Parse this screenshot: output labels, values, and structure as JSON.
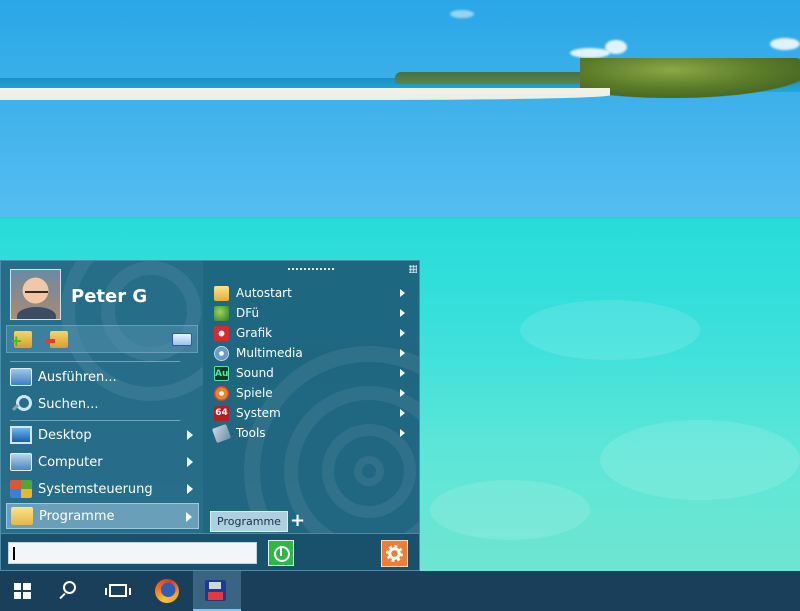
{
  "user": {
    "name": "Peter G"
  },
  "left_menu": {
    "items": [
      {
        "label": "Ausführen...",
        "icon": "run-icon",
        "has_arrow": false
      },
      {
        "label": "Suchen...",
        "icon": "search-icon",
        "has_arrow": false
      },
      {
        "label": "Desktop",
        "icon": "desktop-icon",
        "has_arrow": true
      },
      {
        "label": "Computer",
        "icon": "computer-icon",
        "has_arrow": true
      },
      {
        "label": "Systemsteuerung",
        "icon": "control-panel-icon",
        "has_arrow": true
      },
      {
        "label": "Programme",
        "icon": "programs-folder-icon",
        "has_arrow": true,
        "active": true
      }
    ]
  },
  "programs": {
    "items": [
      {
        "label": "Autostart",
        "icon": "folder-icon"
      },
      {
        "label": "DFü",
        "icon": "network-icon"
      },
      {
        "label": "Grafik",
        "icon": "graphics-icon"
      },
      {
        "label": "Multimedia",
        "icon": "media-disc-icon"
      },
      {
        "label": "Sound",
        "icon": "audition-icon",
        "icon_text": "Au"
      },
      {
        "label": "Spiele",
        "icon": "games-icon"
      },
      {
        "label": "System",
        "icon": "c64-icon",
        "icon_text": "64"
      },
      {
        "label": "Tools",
        "icon": "tools-icon"
      }
    ],
    "tab_label": "Programme",
    "add_tab_label": "+"
  },
  "search": {
    "value": "",
    "placeholder": ""
  },
  "colors": {
    "power_button": "#2fb64b",
    "settings_button": "#f07d35",
    "menu_background": "#1c5c7a",
    "taskbar": "#1a3f5a"
  },
  "taskbar": {
    "buttons": [
      {
        "name": "start-button",
        "icon": "windows-logo-icon"
      },
      {
        "name": "search-button",
        "icon": "search-icon"
      },
      {
        "name": "task-view-button",
        "icon": "task-view-icon"
      },
      {
        "name": "firefox-button",
        "icon": "firefox-icon"
      },
      {
        "name": "app-button",
        "icon": "floppy-disk-icon",
        "active": true
      }
    ]
  }
}
